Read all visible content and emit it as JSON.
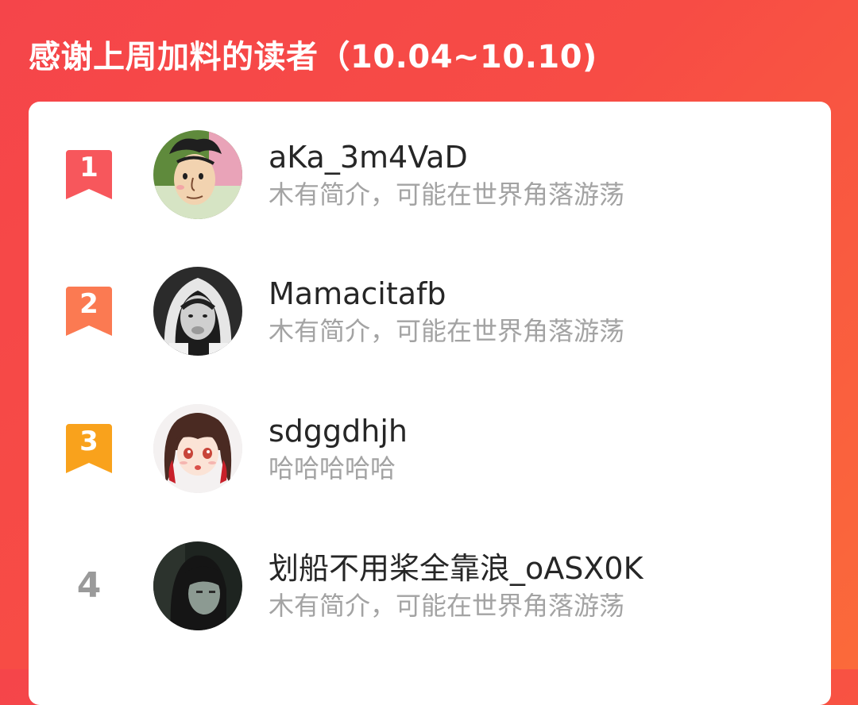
{
  "header": {
    "title": "感谢上周加料的读者（10.04~10.10)"
  },
  "readers": [
    {
      "rank": "1",
      "rank_color": "#f7575c",
      "avatar": "cartoon-boy-avatar",
      "name": "aKa_3m4VaD",
      "bio": "木有简介，可能在世界角落游荡"
    },
    {
      "rank": "2",
      "rank_color": "#fb7a52",
      "avatar": "hooded-man-avatar",
      "name": "Mamacitafb",
      "bio": "木有简介，可能在世界角落游荡"
    },
    {
      "rank": "3",
      "rank_color": "#f9a21c",
      "avatar": "anime-girl-avatar",
      "name": "sdggdhjh",
      "bio": "哈哈哈哈哈"
    },
    {
      "rank": "4",
      "avatar": "dark-anime-avatar",
      "name": "划船不用桨全靠浪_oASX0K",
      "bio": "木有简介，可能在世界角落游荡"
    }
  ]
}
